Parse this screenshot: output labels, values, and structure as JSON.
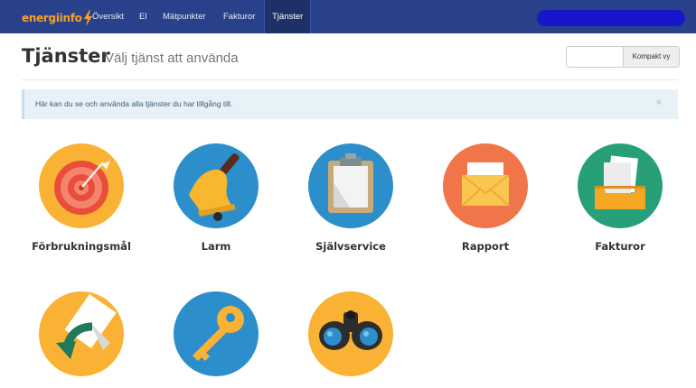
{
  "nav": {
    "logo": "energiinfo",
    "items": [
      {
        "label": "Översikt"
      },
      {
        "label": "El"
      },
      {
        "label": "Mätpunkter"
      },
      {
        "label": "Fakturor"
      },
      {
        "label": "Tjänster"
      }
    ],
    "active": "Tjänster"
  },
  "header": {
    "title": "Tjänster",
    "subtitle": "Välj tjänst att använda",
    "compact_button": "Kompakt vy",
    "compact_input_value": ""
  },
  "alert": {
    "text": "Här kan du se och använda alla tjänster du har tillgång till.",
    "close": "×"
  },
  "services": [
    {
      "label": "Förbrukningsmål",
      "icon": "target-icon",
      "color": "#f9b233"
    },
    {
      "label": "Larm",
      "icon": "bell-icon",
      "color": "#2c8ecb"
    },
    {
      "label": "Självservice",
      "icon": "clipboard-icon",
      "color": "#2c8ecb"
    },
    {
      "label": "Rapport",
      "icon": "envelope-icon",
      "color": "#f07548"
    },
    {
      "label": "Fakturor",
      "icon": "invoice-tray-icon",
      "color": "#27a079"
    },
    {
      "label": "",
      "icon": "document-return-icon",
      "color": "#f9b233"
    },
    {
      "label": "",
      "icon": "key-icon",
      "color": "#2c8ecb"
    },
    {
      "label": "",
      "icon": "binoculars-icon",
      "color": "#f9b233"
    }
  ],
  "colors": {
    "navbar": "#29418a",
    "accent": "#f4a12b",
    "text": "#333333"
  }
}
